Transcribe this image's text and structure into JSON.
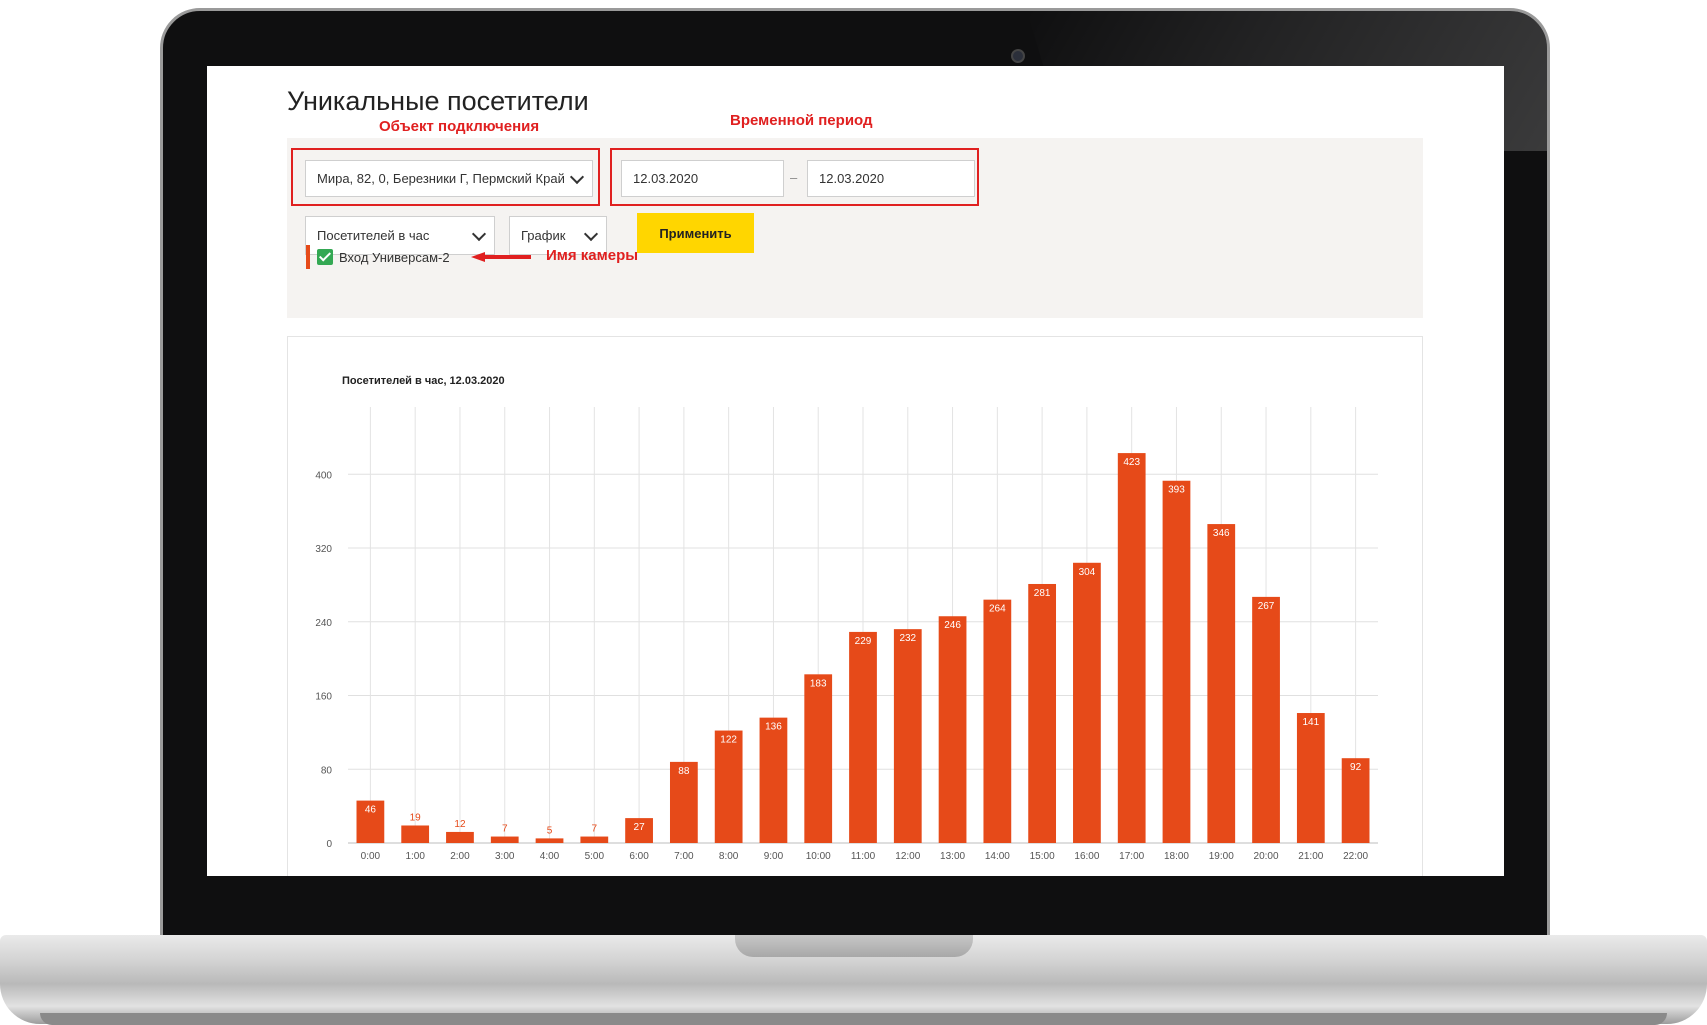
{
  "page": {
    "title": "Уникальные посетители"
  },
  "annotations": {
    "object_label": "Объект подключения",
    "period_label": "Временной период",
    "camera_label": "Имя камеры"
  },
  "filters": {
    "object_select": "Мира, 82, 0, Березники Г, Пермский Край",
    "date_from": "12.03.2020",
    "date_separator": "–",
    "date_to": "12.03.2020",
    "metric_select": "Посетителей в час",
    "view_select": "График",
    "apply_label": "Применить",
    "camera_name": "Вход Универсам-2",
    "camera_checked": true
  },
  "colors": {
    "bar": "#e64a19",
    "accent_button": "#ffd600",
    "annotation": "#e02020",
    "checkbox": "#34a853"
  },
  "chart_data": {
    "type": "bar",
    "title": "Посетителей в час, 12.03.2020",
    "categories": [
      "0:00",
      "1:00",
      "2:00",
      "3:00",
      "4:00",
      "5:00",
      "6:00",
      "7:00",
      "8:00",
      "9:00",
      "10:00",
      "11:00",
      "12:00",
      "13:00",
      "14:00",
      "15:00",
      "16:00",
      "17:00",
      "18:00",
      "19:00",
      "20:00",
      "21:00",
      "22:00"
    ],
    "values": [
      46,
      19,
      12,
      7,
      5,
      7,
      27,
      88,
      122,
      136,
      183,
      229,
      232,
      246,
      264,
      281,
      304,
      423,
      393,
      346,
      267,
      141,
      92
    ],
    "yticks": [
      0,
      80,
      160,
      240,
      320,
      400
    ],
    "ylim": [
      0,
      473
    ],
    "grid": true,
    "legend": "none"
  }
}
